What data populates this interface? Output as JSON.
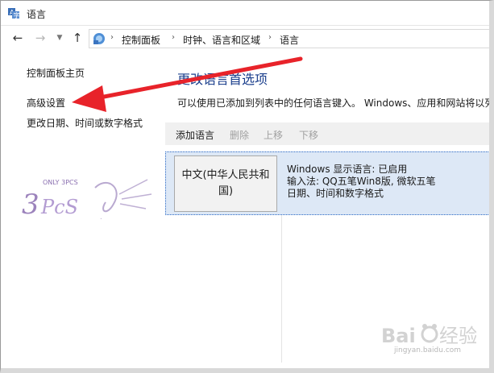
{
  "window": {
    "title": "语言"
  },
  "address_bar": {
    "breadcrumbs": [
      "控制面板",
      "时钟、语言和区域",
      "语言"
    ],
    "icons": {
      "back": "arrow-left-icon",
      "forward": "arrow-right-icon",
      "recent": "chevron-down-icon",
      "up": "arrow-up-icon"
    }
  },
  "left_nav": {
    "items": [
      {
        "label": "控制面板主页"
      },
      {
        "label": "高级设置"
      },
      {
        "label": "更改日期、时间或数字格式"
      }
    ]
  },
  "main": {
    "heading": "更改语言首选项",
    "description": "可以使用已添加到列表中的任何语言键入。 Windows、应用和网站将以列表中第一",
    "toolbar": {
      "add": "添加语言",
      "remove": "删除",
      "move_up": "上移",
      "move_down": "下移"
    },
    "languages": [
      {
        "name": "中文(中华人民共和国)",
        "details": [
          "Windows 显示语言: 已启用",
          "输入法: QQ五笔Win8版, 微软五笔",
          "日期、时间和数字格式"
        ]
      }
    ]
  },
  "overlays": {
    "watermark_text": "ONLY 3PCS",
    "baidu_watermark": "jingyan.baidu.com",
    "arrow_color": "#e8232a"
  },
  "colors": {
    "heading": "#1a3e8c",
    "selection_bg": "#dde8f6",
    "selection_border": "#2c6ac6",
    "toolbar_bg": "#f0f0f0",
    "disabled_text": "#a0a0a0"
  }
}
